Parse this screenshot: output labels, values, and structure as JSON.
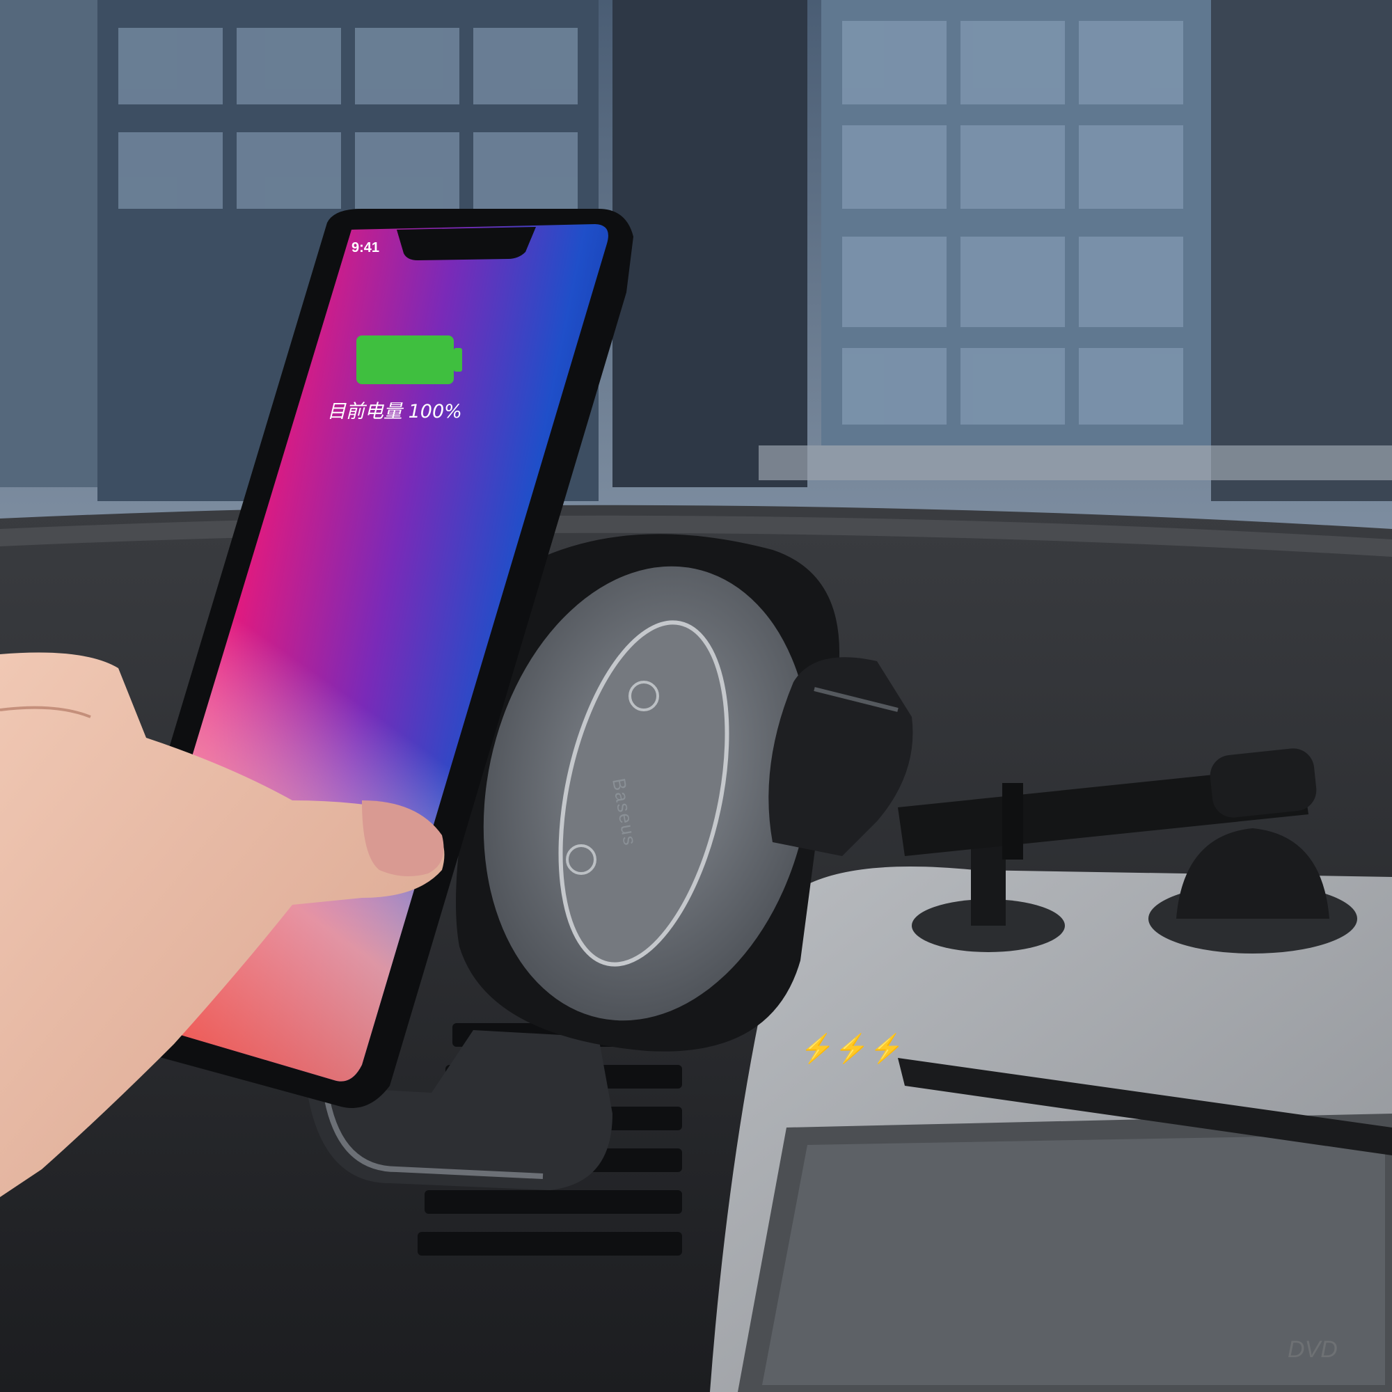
{
  "photo": {
    "subject": "wireless charging car phone mount",
    "phone": {
      "status_time": "9:41",
      "battery_label": "目前电量 100%",
      "battery_level": 1.0,
      "battery_color": "#3fbf3f"
    },
    "mount": {
      "brand": "Baseus"
    },
    "dashboard": {
      "charge_symbol": "⚡⚡⚡",
      "media_label": "DVD"
    },
    "colors": {
      "sky_building": "#5a6e84",
      "dashboard": "#2a2c2f",
      "dash_panel": "#a9acb0",
      "mount_black": "#1b1c1e"
    }
  }
}
